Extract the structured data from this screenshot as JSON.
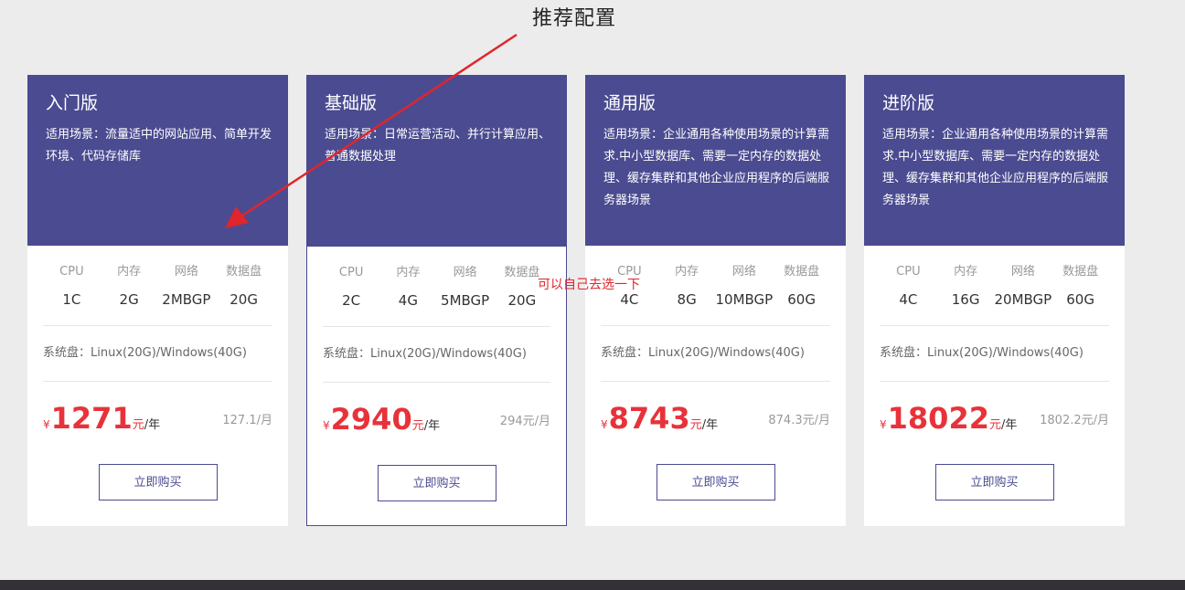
{
  "annotation": {
    "title": "推荐配置",
    "note": "可以自己去选一下",
    "arrow_color": "#e0252c"
  },
  "colors": {
    "header_bg": "#4b4b91",
    "price_red": "#e8323a",
    "page_bg": "#ececec"
  },
  "plans": [
    {
      "title": "入门版",
      "desc": "适用场景：流量适中的网站应用、简单开发环境、代码存储库",
      "specs": [
        {
          "label": "CPU",
          "value": "1C"
        },
        {
          "label": "内存",
          "value": "2G"
        },
        {
          "label": "网络",
          "value": "2MBGP"
        },
        {
          "label": "数据盘",
          "value": "20G"
        }
      ],
      "sys_disk": "系统盘：Linux(20G)/Windows(40G)",
      "currency": "¥",
      "price": "1271",
      "price_unit": "元",
      "price_period": "/年",
      "monthly": "127.1/月",
      "buy_label": "立即购买"
    },
    {
      "title": "基础版",
      "desc": "适用场景：日常运营活动、并行计算应用、普通数据处理",
      "specs": [
        {
          "label": "CPU",
          "value": "2C"
        },
        {
          "label": "内存",
          "value": "4G"
        },
        {
          "label": "网络",
          "value": "5MBGP"
        },
        {
          "label": "数据盘",
          "value": "20G"
        }
      ],
      "sys_disk": "系统盘：Linux(20G)/Windows(40G)",
      "currency": "¥",
      "price": "2940",
      "price_unit": "元",
      "price_period": "/年",
      "monthly": "294元/月",
      "buy_label": "立即购买"
    },
    {
      "title": "通用版",
      "desc": "适用场景：企业通用各种使用场景的计算需求.中小型数据库、需要一定内存的数据处理、缓存集群和其他企业应用程序的后端服务器场景",
      "specs": [
        {
          "label": "CPU",
          "value": "4C"
        },
        {
          "label": "内存",
          "value": "8G"
        },
        {
          "label": "网络",
          "value": "10MBGP"
        },
        {
          "label": "数据盘",
          "value": "60G"
        }
      ],
      "sys_disk": "系统盘：Linux(20G)/Windows(40G)",
      "currency": "¥",
      "price": "8743",
      "price_unit": "元",
      "price_period": "/年",
      "monthly": "874.3元/月",
      "buy_label": "立即购买"
    },
    {
      "title": "进阶版",
      "desc": "适用场景：企业通用各种使用场景的计算需求.中小型数据库、需要一定内存的数据处理、缓存集群和其他企业应用程序的后端服务器场景",
      "specs": [
        {
          "label": "CPU",
          "value": "4C"
        },
        {
          "label": "内存",
          "value": "16G"
        },
        {
          "label": "网络",
          "value": "20MBGP"
        },
        {
          "label": "数据盘",
          "value": "60G"
        }
      ],
      "sys_disk": "系统盘：Linux(20G)/Windows(40G)",
      "currency": "¥",
      "price": "18022",
      "price_unit": "元",
      "price_period": "/年",
      "monthly": "1802.2元/月",
      "buy_label": "立即购买"
    }
  ]
}
